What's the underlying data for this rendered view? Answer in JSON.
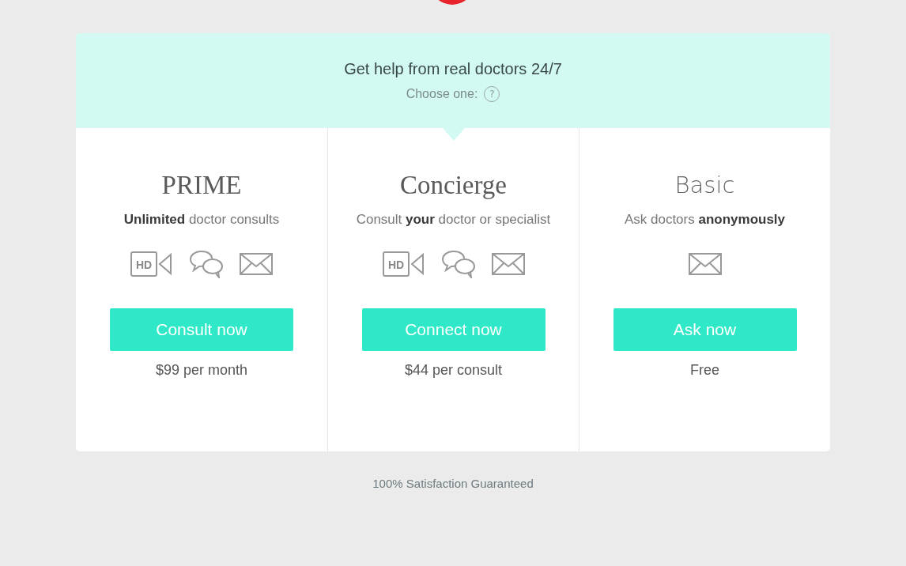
{
  "header": {
    "title": "Get help from real doctors 24/7",
    "subtitle": "Choose one:",
    "help_icon": "?"
  },
  "plans": [
    {
      "name": "PRIME",
      "kind": "paid",
      "tagline": "**Unlimited** doctor consults",
      "features": [
        {
          "kind": "video",
          "label": "HD"
        },
        {
          "kind": "chat"
        },
        {
          "kind": "mail"
        }
      ],
      "button": "Consult now",
      "price": "$99 per month",
      "selected": false
    },
    {
      "name": "Concierge",
      "kind": "paid",
      "tagline": "Consult **your** doctor or specialist",
      "features": [
        {
          "kind": "video",
          "label": "HD"
        },
        {
          "kind": "chat"
        },
        {
          "kind": "mail"
        }
      ],
      "button": "Connect now",
      "price": "$44 per consult",
      "selected": true
    },
    {
      "name": "Basic",
      "kind": "free",
      "tagline": "Ask doctors **anonymously**",
      "features": [
        {
          "kind": "mail"
        }
      ],
      "button": "Ask now",
      "price": "Free",
      "selected": false
    }
  ],
  "footer": "100% Satisfaction Guaranteed"
}
